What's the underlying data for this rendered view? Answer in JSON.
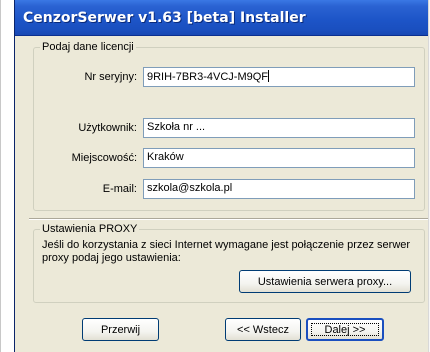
{
  "window": {
    "title": "CenzorSerwer v1.63 [beta] Installer"
  },
  "license_group": {
    "legend": "Podaj dane licencji",
    "fields": [
      {
        "label": "Nr seryjny:",
        "value": "9RIH-7BR3-4VCJ-M9QF"
      },
      {
        "label": "Użytkownik:",
        "value": "Szkoła nr ..."
      },
      {
        "label": "Miejscowość:",
        "value": "Kraków"
      },
      {
        "label": "E-mail:",
        "value": "szkola@szkola.pl"
      }
    ]
  },
  "proxy_group": {
    "legend": "Ustawienia PROXY",
    "description": "Jeśli do korzystania z sieci Internet wymagane jest połączenie przez serwer proxy podaj jego ustawienia:",
    "button_label": "Ustawienia serwera proxy..."
  },
  "footer": {
    "cancel_label": "Przerwij",
    "back_label": "<< Wstecz",
    "next_label": "Dalej >>"
  }
}
